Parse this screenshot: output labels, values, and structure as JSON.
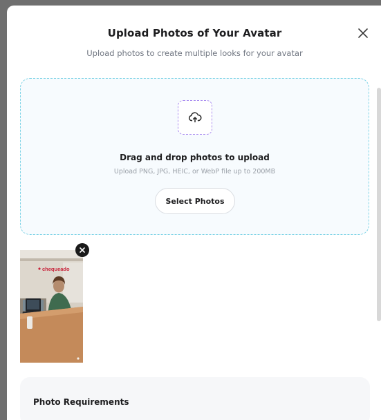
{
  "modal": {
    "title": "Upload Photos of Your Avatar",
    "subtitle": "Upload photos to create multiple looks for your avatar",
    "close_icon": "close-icon"
  },
  "dropzone": {
    "icon": "cloud-upload-icon",
    "title": "Drag and drop photos to upload",
    "subtitle": "Upload PNG, JPG, HEIC, or WebP file up to 200MB",
    "select_label": "Select Photos"
  },
  "photos": [
    {
      "sign_text": "chequeado",
      "remove_icon": "remove-photo-icon"
    }
  ],
  "requirements": {
    "title": "Photo Requirements"
  },
  "colors": {
    "dropzone_border": "#7dd3e6",
    "icon_border": "#a98cf0",
    "sign_red": "#c8233a"
  }
}
